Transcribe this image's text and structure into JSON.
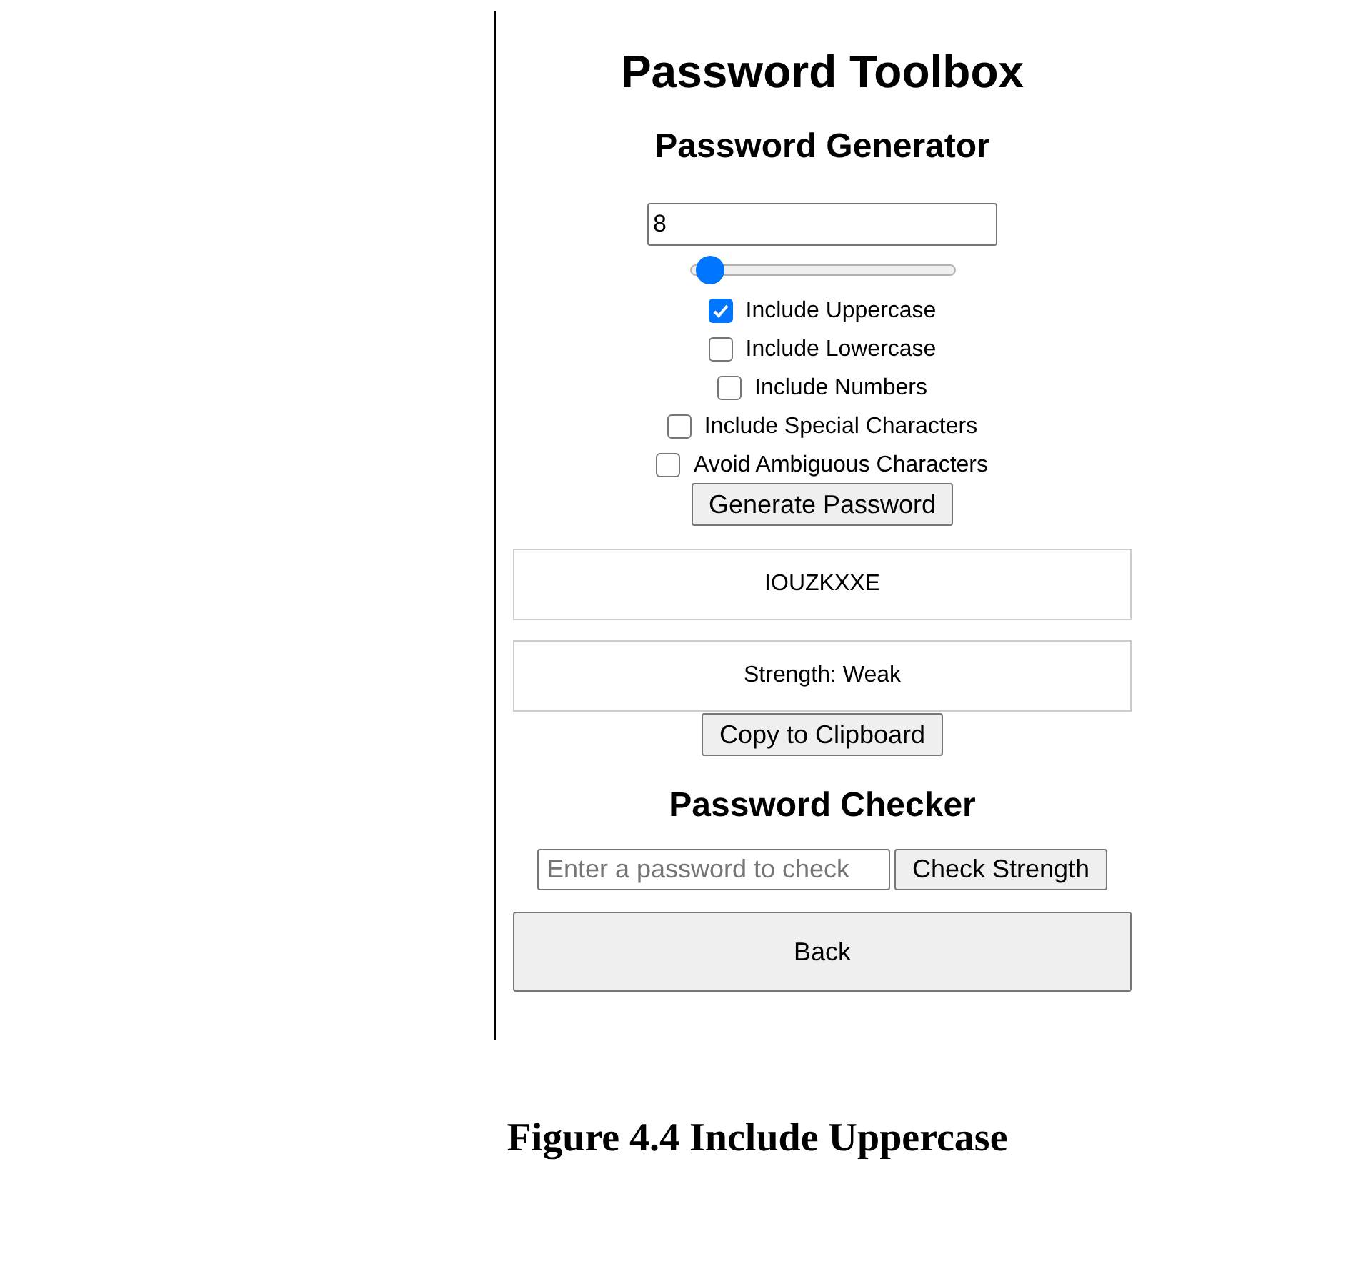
{
  "title": "Password Toolbox",
  "generator": {
    "heading": "Password Generator",
    "length_value": "8",
    "slider": {
      "level": 0.03
    },
    "options": [
      {
        "label": "Include Uppercase",
        "checked": true
      },
      {
        "label": "Include Lowercase",
        "checked": false
      },
      {
        "label": "Include Numbers",
        "checked": false
      },
      {
        "label": "Include Special Characters",
        "checked": false
      },
      {
        "label": "Avoid Ambiguous Characters",
        "checked": false
      }
    ],
    "generate_button": "Generate Password",
    "password": "IOUZKXXE",
    "strength": "Strength: Weak",
    "copy_button": "Copy to Clipboard"
  },
  "checker": {
    "heading": "Password Checker",
    "placeholder": "Enter a password to check",
    "check_button": "Check Strength"
  },
  "back_button": "Back",
  "caption": "Figure 4.4 Include Uppercase"
}
